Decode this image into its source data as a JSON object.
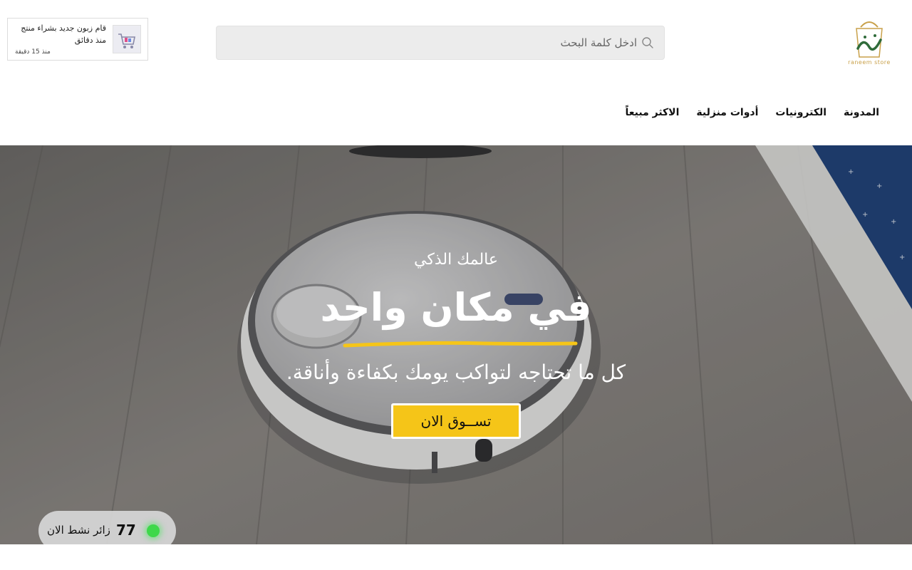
{
  "header": {
    "logo_alt": "raneem store",
    "search": {
      "placeholder": "ادخل كلمة البحث",
      "value": ""
    },
    "notification": {
      "message": "قام زبون جديد بشراء منتج منذ دقائق",
      "time": "منذ 15 دقيقة"
    },
    "nav": [
      {
        "label": "المدونة"
      },
      {
        "label": "الكترونيات"
      },
      {
        "label": "أدوات منزلية"
      },
      {
        "label": "الاكثر مبيعاً"
      }
    ]
  },
  "hero": {
    "subtitle": "عالمك الذكي",
    "title": "في مكان واحد",
    "description": "كل ما تحتاجه لتواكب يومك بكفاءة وأناقة.",
    "cta_label": "تســوق الان"
  },
  "visitors": {
    "count": "77",
    "label": "زائر نشط الان"
  },
  "colors": {
    "accent": "#f5c518",
    "online": "#3ed84a",
    "logo_green": "#2f6b3a",
    "logo_gold": "#c9a14a"
  }
}
